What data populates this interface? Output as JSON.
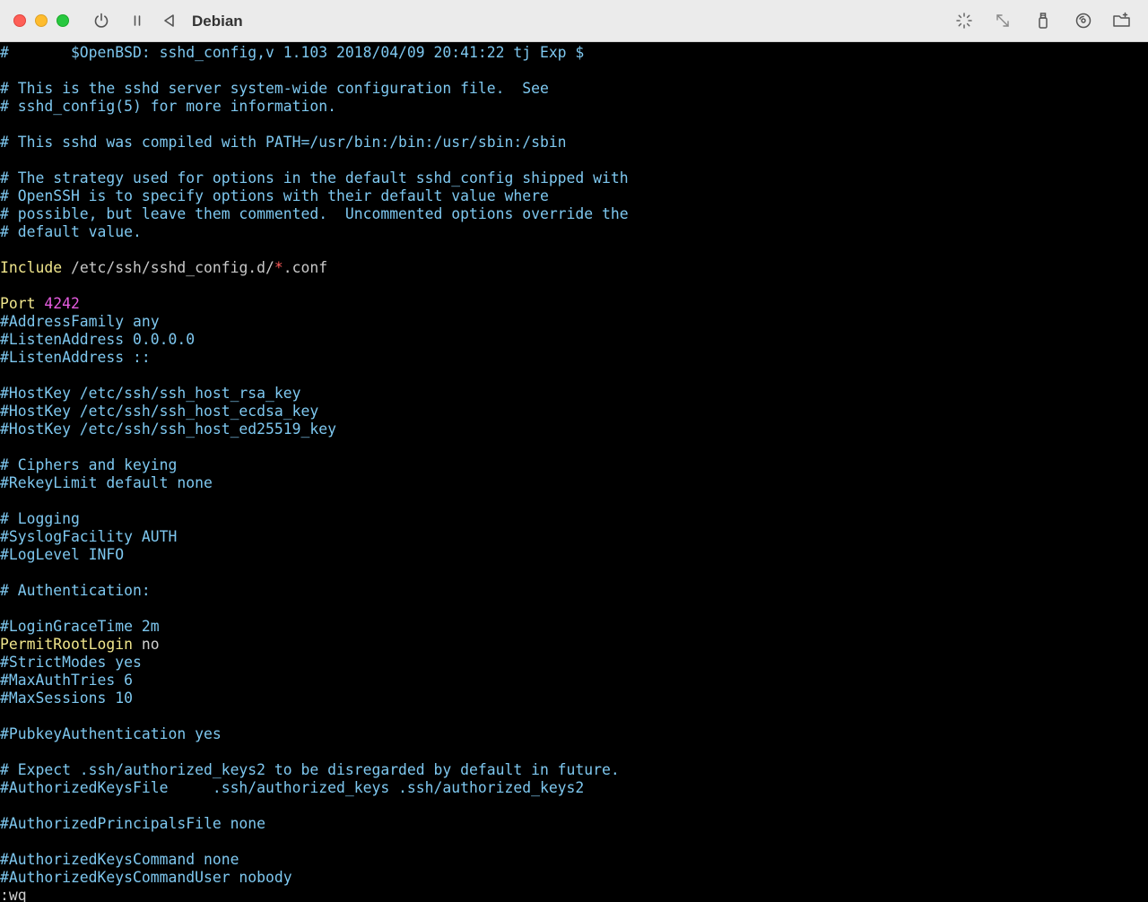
{
  "window": {
    "title": "Debian",
    "icons": {
      "power": "power-icon",
      "pause": "pause-icon",
      "back": "back-icon",
      "brightness": "brightness-icon",
      "resize": "resize-icon",
      "usb": "usb-icon",
      "cd": "disc-icon",
      "folder": "shared-folder-icon"
    },
    "colors": {
      "close": "#fe5f57",
      "minimize": "#febc2e",
      "maximize": "#28c840"
    }
  },
  "editor": {
    "colors": {
      "comment": "#7ec8f0",
      "keyword": "#f0e68c",
      "number": "#e65ce0",
      "glob": "#ff5a5a"
    },
    "lines": [
      {
        "type": "comment",
        "text": "#\t$OpenBSD: sshd_config,v 1.103 2018/04/09 20:41:22 tj Exp $"
      },
      {
        "type": "blank",
        "text": ""
      },
      {
        "type": "comment",
        "text": "# This is the sshd server system-wide configuration file.  See"
      },
      {
        "type": "comment",
        "text": "# sshd_config(5) for more information."
      },
      {
        "type": "blank",
        "text": ""
      },
      {
        "type": "comment",
        "text": "# This sshd was compiled with PATH=/usr/bin:/bin:/usr/sbin:/sbin"
      },
      {
        "type": "blank",
        "text": ""
      },
      {
        "type": "comment",
        "text": "# The strategy used for options in the default sshd_config shipped with"
      },
      {
        "type": "comment",
        "text": "# OpenSSH is to specify options with their default value where"
      },
      {
        "type": "comment",
        "text": "# possible, but leave them commented.  Uncommented options override the"
      },
      {
        "type": "comment",
        "text": "# default value."
      },
      {
        "type": "blank",
        "text": ""
      },
      {
        "type": "include",
        "keyword": "Include",
        "path": " /etc/ssh/sshd_config.d/",
        "glob": "*",
        "suffix": ".conf"
      },
      {
        "type": "blank",
        "text": ""
      },
      {
        "type": "option",
        "keyword": "Port",
        "value": " 4242",
        "value_type": "number"
      },
      {
        "type": "comment",
        "text": "#AddressFamily any"
      },
      {
        "type": "comment",
        "text": "#ListenAddress 0.0.0.0"
      },
      {
        "type": "comment",
        "text": "#ListenAddress ::"
      },
      {
        "type": "blank",
        "text": ""
      },
      {
        "type": "comment",
        "text": "#HostKey /etc/ssh/ssh_host_rsa_key"
      },
      {
        "type": "comment",
        "text": "#HostKey /etc/ssh/ssh_host_ecdsa_key"
      },
      {
        "type": "comment",
        "text": "#HostKey /etc/ssh/ssh_host_ed25519_key"
      },
      {
        "type": "blank",
        "text": ""
      },
      {
        "type": "comment",
        "text": "# Ciphers and keying"
      },
      {
        "type": "comment",
        "text": "#RekeyLimit default none"
      },
      {
        "type": "blank",
        "text": ""
      },
      {
        "type": "comment",
        "text": "# Logging"
      },
      {
        "type": "comment",
        "text": "#SyslogFacility AUTH"
      },
      {
        "type": "comment",
        "text": "#LogLevel INFO"
      },
      {
        "type": "blank",
        "text": ""
      },
      {
        "type": "comment",
        "text": "# Authentication:"
      },
      {
        "type": "blank",
        "text": ""
      },
      {
        "type": "comment",
        "text": "#LoginGraceTime 2m"
      },
      {
        "type": "option",
        "keyword": "PermitRootLogin",
        "value": " no",
        "value_type": "text"
      },
      {
        "type": "comment",
        "text": "#StrictModes yes"
      },
      {
        "type": "comment",
        "text": "#MaxAuthTries 6"
      },
      {
        "type": "comment",
        "text": "#MaxSessions 10"
      },
      {
        "type": "blank",
        "text": ""
      },
      {
        "type": "comment",
        "text": "#PubkeyAuthentication yes"
      },
      {
        "type": "blank",
        "text": ""
      },
      {
        "type": "comment",
        "text": "# Expect .ssh/authorized_keys2 to be disregarded by default in future."
      },
      {
        "type": "comment",
        "text": "#AuthorizedKeysFile     .ssh/authorized_keys .ssh/authorized_keys2"
      },
      {
        "type": "blank",
        "text": ""
      },
      {
        "type": "comment",
        "text": "#AuthorizedPrincipalsFile none"
      },
      {
        "type": "blank",
        "text": ""
      },
      {
        "type": "comment",
        "text": "#AuthorizedKeysCommand none"
      },
      {
        "type": "comment",
        "text": "#AuthorizedKeysCommandUser nobody"
      },
      {
        "type": "cmd",
        "text": ":wq"
      }
    ]
  }
}
